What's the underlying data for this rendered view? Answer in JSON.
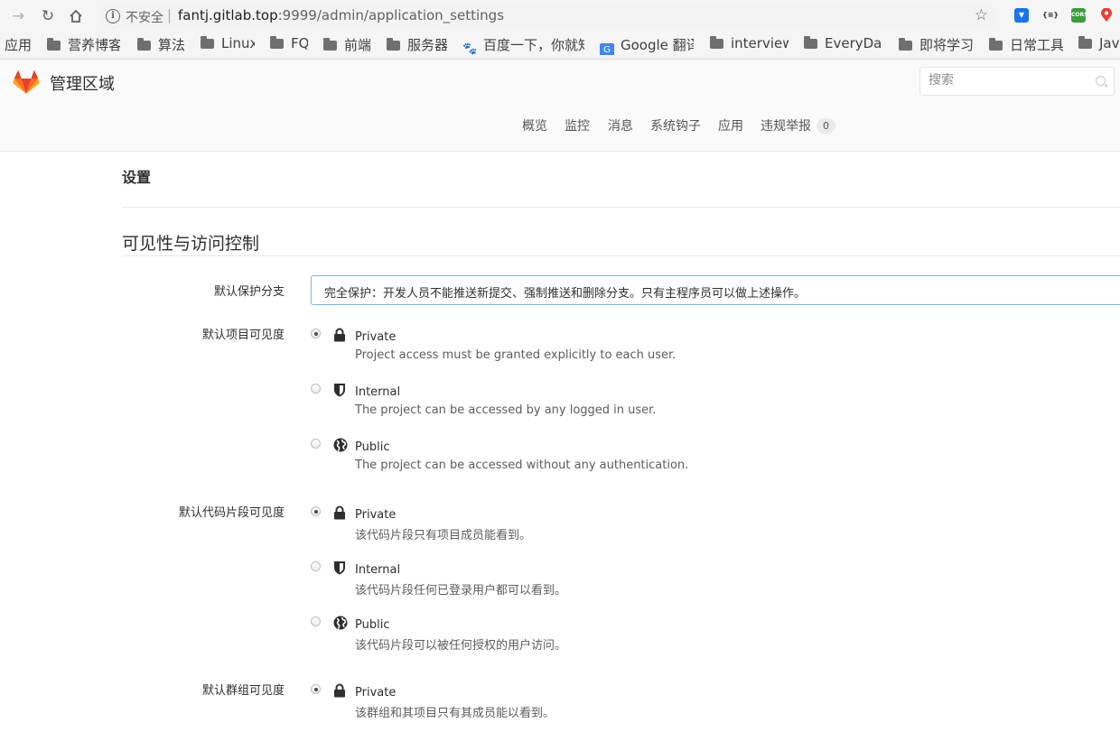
{
  "browser": {
    "insecure_label": "不安全",
    "url_host": "fantj.gitlab.top",
    "url_path": ":9999/admin/application_settings",
    "bookmarks": [
      "应用",
      "营养博客",
      "算法",
      "Linux",
      "FQ",
      "前端",
      "服务器",
      "百度一下，你就知",
      "Google 翻译",
      "interview",
      "EveryDay",
      "即将学习",
      "日常工具",
      "Java"
    ]
  },
  "header": {
    "title": "管理区域",
    "search_placeholder": "搜索",
    "nav": [
      "概览",
      "监控",
      "消息",
      "系统钩子",
      "应用",
      "违规举报"
    ],
    "abuse_count": "0"
  },
  "page": {
    "title": "设置",
    "section_title": "可见性与访问控制",
    "branch_label": "默认保护分支",
    "branch_value": "完全保护：开发人员不能推送新提交、强制推送和删除分支。只有主程序员可以做上述操作。",
    "project_label": "默认项目可见度",
    "project_options": [
      {
        "name": "Private",
        "desc": "Project access must be granted explicitly to each user.",
        "icon": "lock-icon",
        "checked": true
      },
      {
        "name": "Internal",
        "desc": "The project can be accessed by any logged in user.",
        "icon": "shield-icon",
        "checked": false
      },
      {
        "name": "Public",
        "desc": "The project can be accessed without any authentication.",
        "icon": "globe-icon",
        "checked": false
      }
    ],
    "snippet_label": "默认代码片段可见度",
    "snippet_options": [
      {
        "name": "Private",
        "desc": "该代码片段只有项目成员能看到。",
        "icon": "lock-icon",
        "checked": true
      },
      {
        "name": "Internal",
        "desc": "该代码片段任何已登录用户都可以看到。",
        "icon": "shield-icon",
        "checked": false
      },
      {
        "name": "Public",
        "desc": "该代码片段可以被任何授权的用户访问。",
        "icon": "globe-icon",
        "checked": false
      }
    ],
    "group_label": "默认群组可见度",
    "group_options": [
      {
        "name": "Private",
        "desc": "该群组和其项目只有其成员能以看到。",
        "icon": "lock-icon",
        "checked": true
      }
    ]
  },
  "colors": {
    "accent": "#e24329",
    "select_border": "#7cb4e4"
  }
}
